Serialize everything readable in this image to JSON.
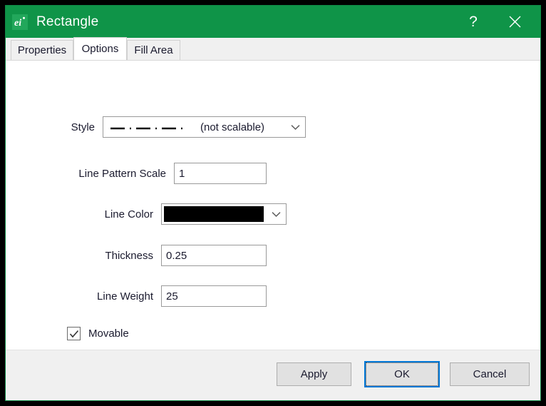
{
  "window": {
    "title": "Rectangle",
    "icon": "app-ei-icon",
    "title_bar_color": "#0f9448",
    "help_button": "?",
    "close_button": "✕"
  },
  "tabs": [
    {
      "label": "Properties",
      "active": false
    },
    {
      "label": "Options",
      "active": true
    },
    {
      "label": "Fill Area",
      "active": false
    }
  ],
  "form": {
    "style": {
      "label": "Style",
      "pattern_name": "dash-dot",
      "value_text": "(not scalable)",
      "dash_count": 4
    },
    "line_pattern_scale": {
      "label": "Line Pattern Scale",
      "value": "1"
    },
    "line_color": {
      "label": "Line Color",
      "value": "#000000"
    },
    "thickness": {
      "label": "Thickness",
      "value": "0.25"
    },
    "line_weight": {
      "label": "Line Weight",
      "value": "25"
    },
    "movable": {
      "label": "Movable",
      "checked": true
    }
  },
  "footer": {
    "apply": "Apply",
    "ok": "OK",
    "cancel": "Cancel",
    "focus_color": "#0078d7"
  }
}
